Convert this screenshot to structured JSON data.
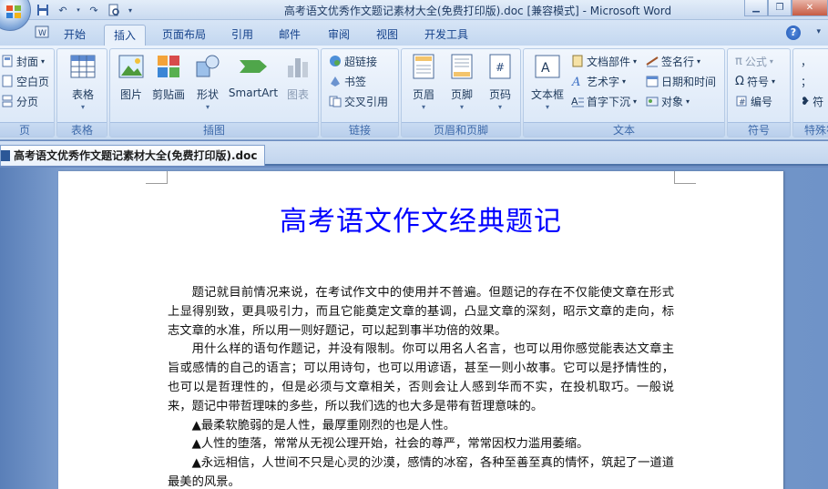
{
  "window": {
    "title": "高考语文优秀作文题记素材大全(免费打印版).doc [兼容模式] - Microsoft Word"
  },
  "ribbon_tabs": [
    "开始",
    "插入",
    "页面布局",
    "引用",
    "邮件",
    "审阅",
    "视图",
    "开发工具"
  ],
  "active_tab": "插入",
  "groups": {
    "pages": {
      "label": "页",
      "items": [
        "封面",
        "空白页",
        "分页"
      ]
    },
    "tables": {
      "label": "表格",
      "button": "表格"
    },
    "illustrations": {
      "label": "插图",
      "buttons": [
        "图片",
        "剪贴画",
        "形状",
        "SmartArt",
        "图表"
      ]
    },
    "links": {
      "label": "链接",
      "items": [
        "超链接",
        "书签",
        "交叉引用"
      ]
    },
    "header_footer": {
      "label": "页眉和页脚",
      "buttons": [
        "页眉",
        "页脚",
        "页码"
      ]
    },
    "text": {
      "label": "文本",
      "textbox": "文本框",
      "col1": [
        "文档部件",
        "艺术字",
        "首字下沉"
      ],
      "col2": [
        "签名行",
        "日期和时间",
        "对象"
      ]
    },
    "symbols": {
      "label": "符号",
      "items": [
        "公式",
        "符号",
        "编号"
      ]
    },
    "special": {
      "label": "特殊符",
      "items": [
        "，",
        "；",
        "符"
      ]
    }
  },
  "document_tab": "高考语文优秀作文题记素材大全(免费打印版).doc",
  "document": {
    "title": "高考语文作文经典题记",
    "paragraphs": [
      "题记就目前情况来说，在考试作文中的使用并不普遍。但题记的存在不仅能使文章在形式上显得别致，更具吸引力，而且它能奠定文章的基调，凸显文章的深刻，昭示文章的走向，标志文章的水准，所以用一则好题记，可以起到事半功倍的效果。",
      "用什么样的语句作题记，并没有限制。你可以用名人名言，也可以用你感觉能表达文章主旨或感情的自己的语言；可以用诗句，也可以用谚语，甚至一则小故事。它可以是抒情性的，也可以是哲理性的，但是必须与文章相关，否则会让人感到华而不实，在投机取巧。一般说来，题记中带哲理味的多些，所以我们选的也大多是带有哲理意味的。",
      "▲最柔软脆弱的是人性，最厚重刚烈的也是人性。",
      "▲人性的堕落，常常从无视公理开始，社会的尊严，常常因权力滥用萎缩。",
      "▲永远相信，人世间不只是心灵的沙漠，感情的冰窑，各种至善至真的情怀，筑起了一道道最美的风景。"
    ]
  }
}
